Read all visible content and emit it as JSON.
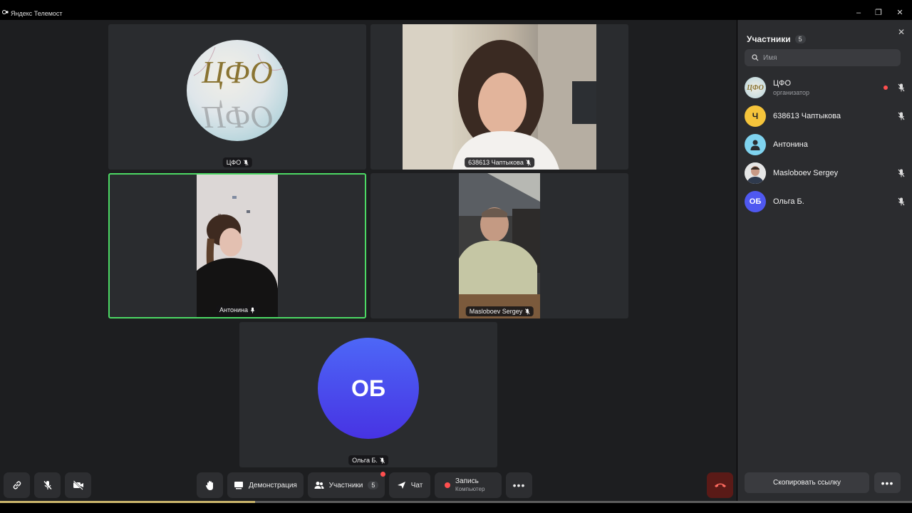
{
  "window": {
    "title": "Яндекс Телемост"
  },
  "tiles": [
    {
      "name": "ЦФО"
    },
    {
      "name": "638613 Чаптыкова"
    },
    {
      "name": "Антонина"
    },
    {
      "name": "Masloboev Sergey"
    },
    {
      "name": "Ольга Б.",
      "initials": "ОБ"
    }
  ],
  "logo": {
    "text": "ЦФО"
  },
  "sidebar": {
    "title": "Участники",
    "count": "5",
    "search_placeholder": "Имя",
    "participants": [
      {
        "name": "ЦФО",
        "role": "организатор",
        "avatar": "logo"
      },
      {
        "name": "638613 Чаптыкова",
        "initial": "Ч",
        "color": "#f5c43b"
      },
      {
        "name": "Антонина",
        "color": "#7fd3ef"
      },
      {
        "name": "Masloboev Sergey",
        "avatar": "photo"
      },
      {
        "name": "Ольга Б.",
        "initial": "ОБ",
        "color": "#4f58f0"
      }
    ],
    "copy_link": "Скопировать ссылку"
  },
  "toolbar": {
    "demo": "Демонстрация",
    "participants": "Участники",
    "participants_count": "5",
    "chat": "Чат",
    "record": "Запись",
    "record_sub": "Компьютер"
  },
  "colors": {
    "accent_green": "#4cd964",
    "avatar_ob": "#4f58f0",
    "red": "#ff4f4f"
  },
  "progress_fraction": 0.28
}
